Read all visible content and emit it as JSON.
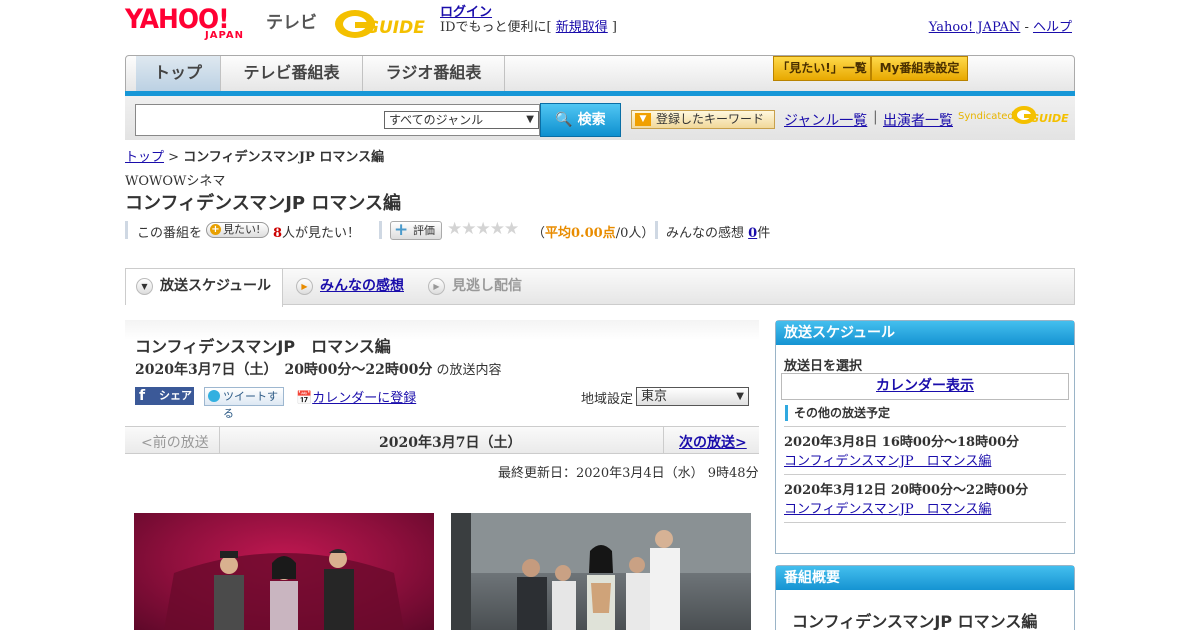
{
  "header": {
    "yahoo_logo_top": "YAHOO!",
    "yahoo_logo_bottom": "JAPAN",
    "tv_label": "テレビ",
    "gguide_logo": "G-GUIDE",
    "login": "ログイン",
    "login_sub_prefix": "IDでもっと便利に[ ",
    "signup": "新規取得",
    "login_sub_suffix": " ]",
    "yahoo_japan_link": "Yahoo! JAPAN",
    "dash": " - ",
    "help_link": "ヘルプ"
  },
  "nav": {
    "tabs": [
      "トップ",
      "テレビ番組表",
      "ラジオ番組表"
    ],
    "mitai_list": "「見たい!」一覧",
    "my_schedule": "My番組表設定"
  },
  "search": {
    "genre_selected": "すべてのジャンル",
    "button": "検索",
    "keyword_button": "登録したキーワード",
    "genre_list": "ジャンル一覧",
    "sep": "|",
    "cast_list": "出演者一覧",
    "syndicated": "Syndicated"
  },
  "breadcrumb": {
    "top": "トップ",
    "sep": " > ",
    "current": "コンフィデンスマンJP ロマンス編"
  },
  "program": {
    "channel": "WOWOWシネマ",
    "title": "コンフィデンスマンJP ロマンス編",
    "stat_prefix": "この番組を",
    "mitai_btn": "見たい!",
    "want_count": "8",
    "want_suffix": "人が見たい！",
    "rate_btn": "評価",
    "stars": "★★★★★",
    "avg_open": "（",
    "avg_value": "平均0.00点",
    "avg_rest": "/0人）",
    "impressions_label": "みんなの感想 ",
    "impressions_count": "0",
    "impressions_unit": "件"
  },
  "content_tabs": [
    "放送スケジュール",
    "みんなの感想",
    "見逃し配信"
  ],
  "broadcast": {
    "title": "コンフィデンスマンJP　ロマンス編",
    "date_time": "2020年3月7日（土）　20時00分～22時00分",
    "date_time_suffix": " の放送内容",
    "share_facebook": "シェア",
    "share_twitter": "ツイートする",
    "calendar_register": "カレンダーに登録",
    "area_label": "地域設定",
    "area_selected": "東京",
    "prev": "<前の放送",
    "current_date": "2020年3月7日（土）",
    "next": "次の放送>",
    "updated": "最終更新日：2020年3月4日（水）  9時48分"
  },
  "sidebar": {
    "schedule_header": "放送スケジュール",
    "select_date": "放送日を選択",
    "calendar_button": "カレンダー表示",
    "other_header": "その他の放送予定",
    "other_schedules": [
      {
        "datetime": "2020年3月8日  16時00分～18時00分",
        "title": "コンフィデンスマンJP　ロマンス編"
      },
      {
        "datetime": "2020年3月12日  20時00分～22時00分",
        "title": "コンフィデンスマンJP　ロマンス編"
      }
    ],
    "overview_header": "番組概要",
    "overview_title": "コンフィデンスマンJP ロマンス編"
  },
  "colors": {
    "accent_blue": "#1797d7",
    "search_button": "#1593d2",
    "yahoo_red": "#ff0033",
    "gold": "#f0a000"
  }
}
